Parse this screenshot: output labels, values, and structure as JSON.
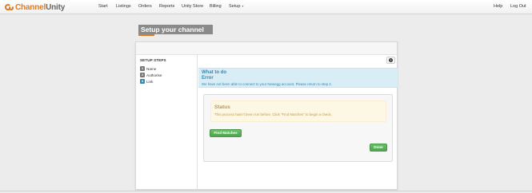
{
  "brand": {
    "part1": "Channel",
    "part2": "Unity"
  },
  "nav": {
    "items": [
      "Start",
      "Listings",
      "Orders",
      "Reports",
      "Unity Store",
      "Billing",
      "Setup"
    ],
    "setup_caret": "▾",
    "right": [
      "Help",
      "Log Out"
    ]
  },
  "page_title": "Setup your channel",
  "sidebar": {
    "heading": "SETUP STEPS",
    "steps": [
      {
        "num": "1",
        "label": "Name",
        "state": "done"
      },
      {
        "num": "2",
        "label": "Authorise",
        "state": "done"
      },
      {
        "num": "3",
        "label": "Link",
        "state": "current"
      }
    ]
  },
  "help_icon": "question-circle-icon",
  "info": {
    "heading": "What to do",
    "title": "Error",
    "text": "We have not been able to connect to your Newegg account. Please return to step 2."
  },
  "status": {
    "title": "Status",
    "text": "This process hasn't been run before. Click \"Find Matches\" to begin a check."
  },
  "buttons": {
    "find": "Find Matches",
    "done": "Done"
  },
  "colors": {
    "accent": "#e07a1f",
    "info_bg": "#d9edf7",
    "warning_bg": "#fcf8e3",
    "success": "#5bb75b"
  }
}
